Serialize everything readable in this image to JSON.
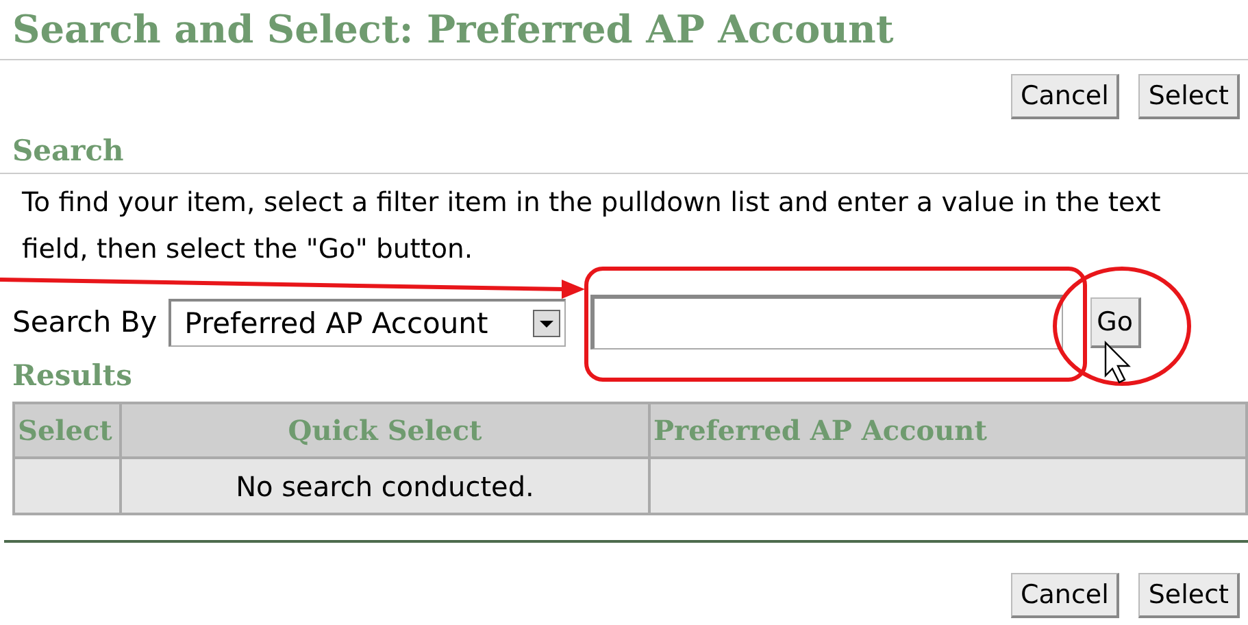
{
  "page": {
    "title": "Search and Select: Preferred AP Account"
  },
  "top_buttons": [
    "Cancel",
    "Select"
  ],
  "search": {
    "heading": "Search",
    "instructions": "To find your item, select a filter item in the pulldown list and enter a value in the text field, then select the \"Go\" button.",
    "search_by_label": "Search By",
    "filter_value": "Preferred AP Account",
    "go_button": "Go"
  },
  "results": {
    "heading": "Results",
    "columns": [
      "Select",
      "Quick Select",
      "Preferred AP Account"
    ],
    "empty_message": "No search conducted."
  },
  "bottom_buttons": [
    "Cancel",
    "Select"
  ]
}
